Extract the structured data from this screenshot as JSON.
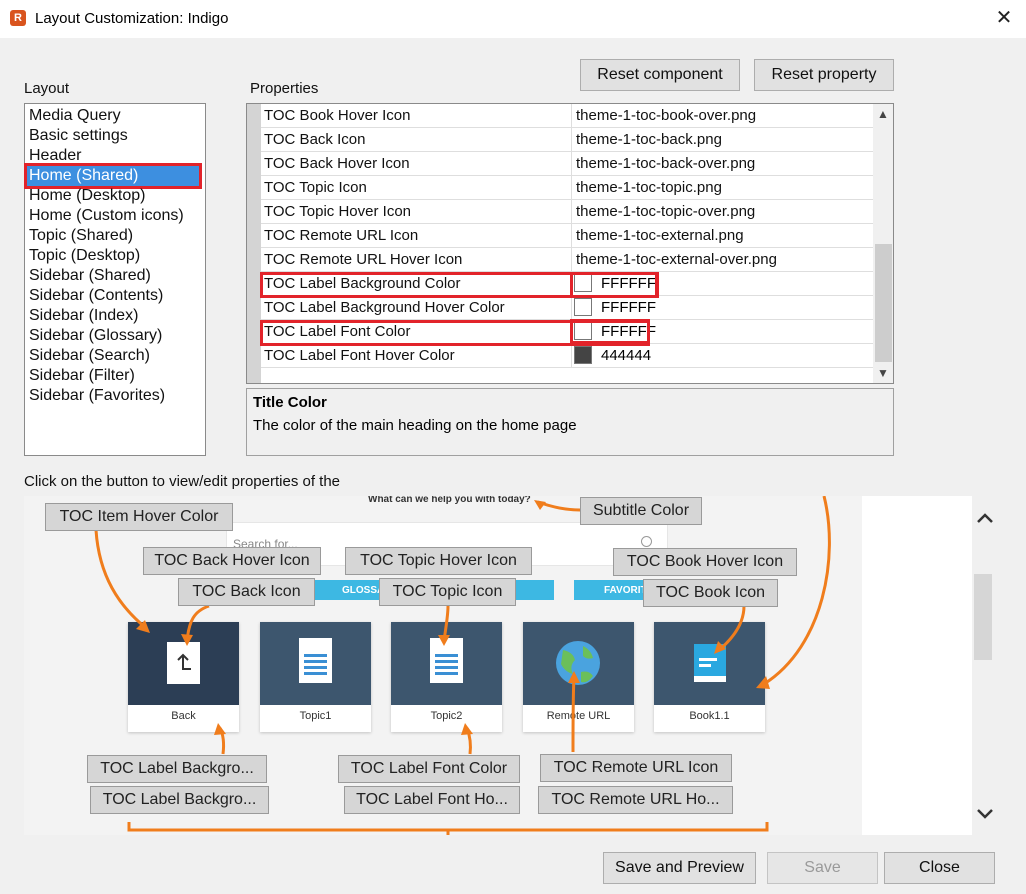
{
  "window": {
    "title": "Layout Customization: Indigo",
    "app_icon": "app-logo-icon",
    "close_glyph": "✕"
  },
  "layout_section": {
    "label": "Layout",
    "items": [
      "Media Query",
      "Basic settings",
      "Header",
      "Home (Shared)",
      "Home (Desktop)",
      "Home (Custom icons)",
      "Topic (Shared)",
      "Topic (Desktop)",
      "Sidebar (Shared)",
      "Sidebar (Contents)",
      "Sidebar (Index)",
      "Sidebar (Glossary)",
      "Sidebar (Search)",
      "Sidebar (Filter)",
      "Sidebar (Favorites)"
    ],
    "selected": "Home (Shared)"
  },
  "properties_section": {
    "label": "Properties",
    "reset_component": "Reset component",
    "reset_property": "Reset property",
    "rows": [
      {
        "name": "TOC Book Hover Icon",
        "value": "theme-1-toc-book-over.png"
      },
      {
        "name": "TOC Back Icon",
        "value": "theme-1-toc-back.png"
      },
      {
        "name": "TOC Back Hover Icon",
        "value": "theme-1-toc-back-over.png"
      },
      {
        "name": "TOC Topic Icon",
        "value": "theme-1-toc-topic.png"
      },
      {
        "name": "TOC Topic Hover Icon",
        "value": "theme-1-toc-topic-over.png"
      },
      {
        "name": "TOC Remote URL Icon",
        "value": "theme-1-toc-external.png"
      },
      {
        "name": "TOC Remote URL Hover Icon",
        "value": "theme-1-toc-external-over.png"
      },
      {
        "name": "TOC Label Background Color",
        "value": "FFFFFF",
        "swatch": "#ffffff"
      },
      {
        "name": "TOC Label Background Hover Color",
        "value": "FFFFFF",
        "swatch": "#ffffff"
      },
      {
        "name": "TOC Label Font Color",
        "value": "FFFFFF",
        "swatch": "#ffffff"
      },
      {
        "name": "TOC Label Font Hover Color",
        "value": "444444",
        "swatch": "#444444"
      }
    ]
  },
  "description": {
    "title": "Title Color",
    "text": "The color of the main heading on the home page"
  },
  "preview": {
    "intro": "Click on the button to view/edit properties of the",
    "subtitle_text": "What can we help you with today?",
    "search_placeholder": "Search for...",
    "tab_glossary": "GLOSSA",
    "tab_favorites": "FAVORIT",
    "callouts": {
      "toc_item_hover_color": "TOC Item Hover Color",
      "subtitle_color": "Subtitle Color",
      "toc_back_hover_icon": "TOC Back Hover Icon",
      "toc_topic_hover_icon": "TOC Topic Hover Icon",
      "toc_book_hover_icon": "TOC Book Hover Icon",
      "toc_back_icon": "TOC Back Icon",
      "toc_topic_icon": "TOC Topic Icon",
      "toc_book_icon": "TOC Book Icon",
      "toc_label_bg_1": "TOC Label Backgro...",
      "toc_label_bg_2": "TOC Label Backgro...",
      "toc_label_font_color": "TOC Label Font Color",
      "toc_label_font_hover": "TOC Label Font Ho...",
      "toc_remote_url_icon": "TOC Remote URL Icon",
      "toc_remote_url_hover": "TOC Remote URL Ho..."
    },
    "tiles": [
      "Back",
      "Topic1",
      "Topic2",
      "Remote URL",
      "Book1.1"
    ],
    "colors": {
      "arrow": "#f07d1c",
      "tile_dark": "#2c3e55",
      "tile": "#3d566e"
    }
  },
  "footer": {
    "save_and_preview": "Save and Preview",
    "save": "Save",
    "close": "Close"
  }
}
